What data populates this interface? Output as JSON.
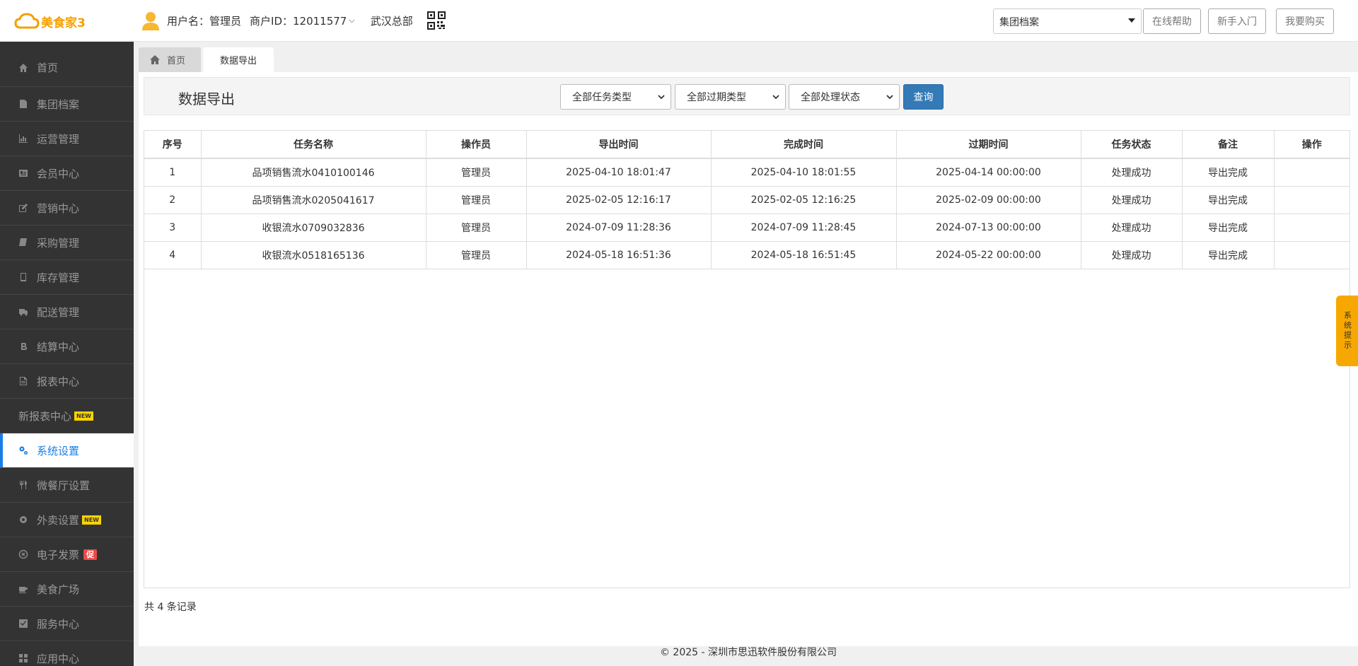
{
  "header": {
    "logo_text": "美食家3",
    "username": "用户名：管理员",
    "merchant_id": "商户ID：12011577",
    "store": "武汉总部",
    "nav_select": "集团档案",
    "buttons": {
      "help": "在线帮助",
      "newbie": "新手入门",
      "buy": "我要购买"
    }
  },
  "sidebar": {
    "items": [
      {
        "label": "首页",
        "icon": "home-icon"
      },
      {
        "label": "集团档案",
        "icon": "file-icon"
      },
      {
        "label": "运营管理",
        "icon": "bar-chart-icon"
      },
      {
        "label": "会员中心",
        "icon": "id-card-icon"
      },
      {
        "label": "营销中心",
        "icon": "edit-icon"
      },
      {
        "label": "采购管理",
        "icon": "book-icon"
      },
      {
        "label": "库存管理",
        "icon": "tablet-icon"
      },
      {
        "label": "配送管理",
        "icon": "truck-icon"
      },
      {
        "label": "结算中心",
        "icon": "bitcoin-icon"
      },
      {
        "label": "报表中心",
        "icon": "report-icon"
      },
      {
        "label": "新报表中心",
        "badge": "NEW"
      },
      {
        "label": "系统设置",
        "icon": "cogs-icon",
        "active": true
      },
      {
        "label": "微餐厅设置",
        "icon": "cutlery-icon"
      },
      {
        "label": "外卖设置",
        "icon": "gear-icon",
        "badge": "NEW"
      },
      {
        "label": "电子发票",
        "icon": "circle-icon",
        "badge": "促"
      },
      {
        "label": "美食广场",
        "icon": "coffee-icon"
      },
      {
        "label": "服务中心",
        "icon": "check-square-icon"
      },
      {
        "label": "应用中心",
        "icon": "grid-icon"
      }
    ]
  },
  "tabs": {
    "home": "首页",
    "current": "数据导出"
  },
  "toolbar": {
    "title": "数据导出",
    "filters": [
      "全部任务类型",
      "全部过期类型",
      "全部处理状态"
    ],
    "query": "查询"
  },
  "table": {
    "columns": [
      "序号",
      "任务名称",
      "操作员",
      "导出时间",
      "完成时间",
      "过期时间",
      "任务状态",
      "备注",
      "操作"
    ],
    "rows": [
      [
        "1",
        "品项销售流水0410100146",
        "管理员",
        "2025-04-10 18:01:47",
        "2025-04-10 18:01:55",
        "2025-04-14 00:00:00",
        "处理成功",
        "导出完成",
        ""
      ],
      [
        "2",
        "品项销售流水0205041617",
        "管理员",
        "2025-02-05 12:16:17",
        "2025-02-05 12:16:25",
        "2025-02-09 00:00:00",
        "处理成功",
        "导出完成",
        ""
      ],
      [
        "3",
        "收银流水0709032836",
        "管理员",
        "2024-07-09 11:28:36",
        "2024-07-09 11:28:45",
        "2024-07-13 00:00:00",
        "处理成功",
        "导出完成",
        ""
      ],
      [
        "4",
        "收银流水0518165136",
        "管理员",
        "2024-05-18 16:51:36",
        "2024-05-18 16:51:45",
        "2024-05-22 00:00:00",
        "处理成功",
        "导出完成",
        ""
      ]
    ]
  },
  "records": "共 4 条记录",
  "footer": "© 2025 - 深圳市思迅软件股份有限公司",
  "side_tip": "系统提示"
}
